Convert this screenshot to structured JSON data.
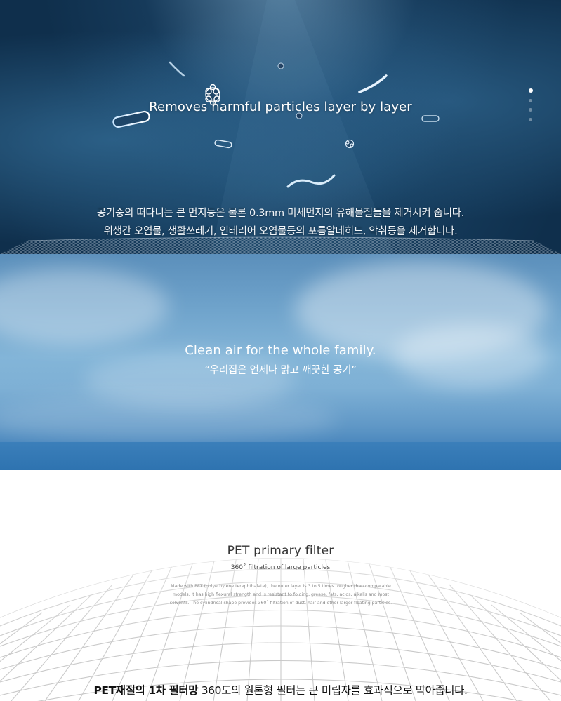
{
  "particles_section": {
    "headline": "Removes harmful particles layer by layer",
    "ko_line1": "공기중의 떠다니는 큰 먼지등은 물론 0.3mm 미세먼지의 유해물질들을 제거시켜 줍니다.",
    "ko_line2": "위생간 오염물, 생활쓰레기, 인테리어 오염물등의 포름알데히드, 악취등을 제거합니다.",
    "slide_dots": {
      "count": 4,
      "active_index": 0
    }
  },
  "sky_section": {
    "title": "Clean air for the whole family.",
    "subtitle": "“우리집은 언제나 맑고 깨끗한 공기”"
  },
  "filter_section": {
    "title": "PET primary filter",
    "subtitle": "360˚ filtration of large particles",
    "description": "Made with PET (polyethylene terephthalate), the outer layer is 3 to 5 times tougher than comparable models. It has high flexural strength and is resistant to folding, grease, fats, acids, alkalis and most solvents. The cylindrical shape provides 360˚ filtration of dust, hair and other larger floating particles.",
    "bottom_strong": "PET재질의 1차 필터망",
    "bottom_rest": " 360도의 원톤형 필터는 큰 미립자를 효과적으로 막아줍니다."
  },
  "colors": {
    "dark_section": "#1d4b70",
    "sky_section": "#83b5d8",
    "text_light": "#ffffff",
    "text_dark": "#111111"
  }
}
